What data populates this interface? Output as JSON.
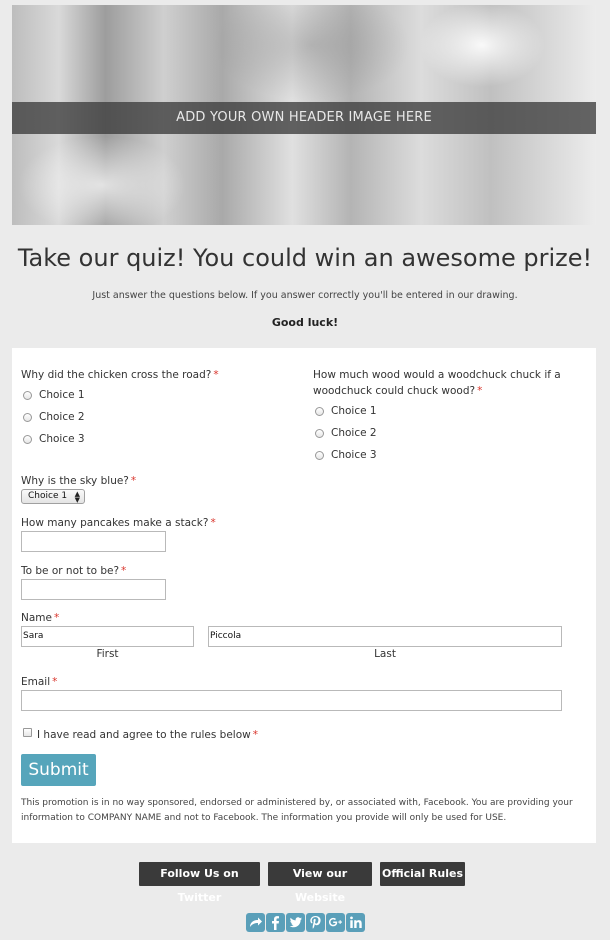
{
  "header": {
    "banner_text": "ADD YOUR OWN HEADER IMAGE HERE"
  },
  "intro": {
    "title": "Take our quiz! You could win an awesome prize!",
    "subtitle": "Just answer the questions below. If you answer correctly you'll be entered in our drawing.",
    "good_luck": "Good luck!"
  },
  "form": {
    "required_marker": "*",
    "q1": {
      "label": "Why did the chicken cross the road?",
      "choices": [
        "Choice 1",
        "Choice 2",
        "Choice 3"
      ]
    },
    "q2": {
      "label_line1": "How much wood would a woodchuck chuck if a",
      "label_line2": "woodchuck could chuck wood?",
      "choices": [
        "Choice 1",
        "Choice 2",
        "Choice 3"
      ]
    },
    "q3": {
      "label": "Why is the sky blue?",
      "selected": "Choice 1"
    },
    "q4": {
      "label": "How many pancakes make a stack?",
      "value": ""
    },
    "q5": {
      "label": "To be or not to be?",
      "value": ""
    },
    "name": {
      "label": "Name",
      "first_value": "Sara",
      "last_value": "Piccola",
      "first_label": "First",
      "last_label": "Last"
    },
    "email": {
      "label": "Email",
      "value": ""
    },
    "agree": {
      "label": "I have read and agree to the rules below"
    },
    "submit_label": "Submit",
    "disclaimer_line1": "This promotion is in no way sponsored, endorsed or administered by, or associated with, Facebook. You are providing your",
    "disclaimer_line2": "information to COMPANY NAME and not to Facebook. The information you provide will only be used for USE."
  },
  "footer": {
    "buttons": [
      "Follow Us on Twitter",
      "View our Website",
      "Official Rules"
    ],
    "social_icons": [
      "share-icon",
      "facebook-icon",
      "twitter-icon",
      "pinterest-icon",
      "google-plus-icon",
      "linkedin-icon"
    ],
    "accent_color": "#5a9fb9"
  },
  "colors": {
    "submit": "#56a5bb",
    "required": "#d9342b",
    "footer_button": "#3a3a3a"
  }
}
